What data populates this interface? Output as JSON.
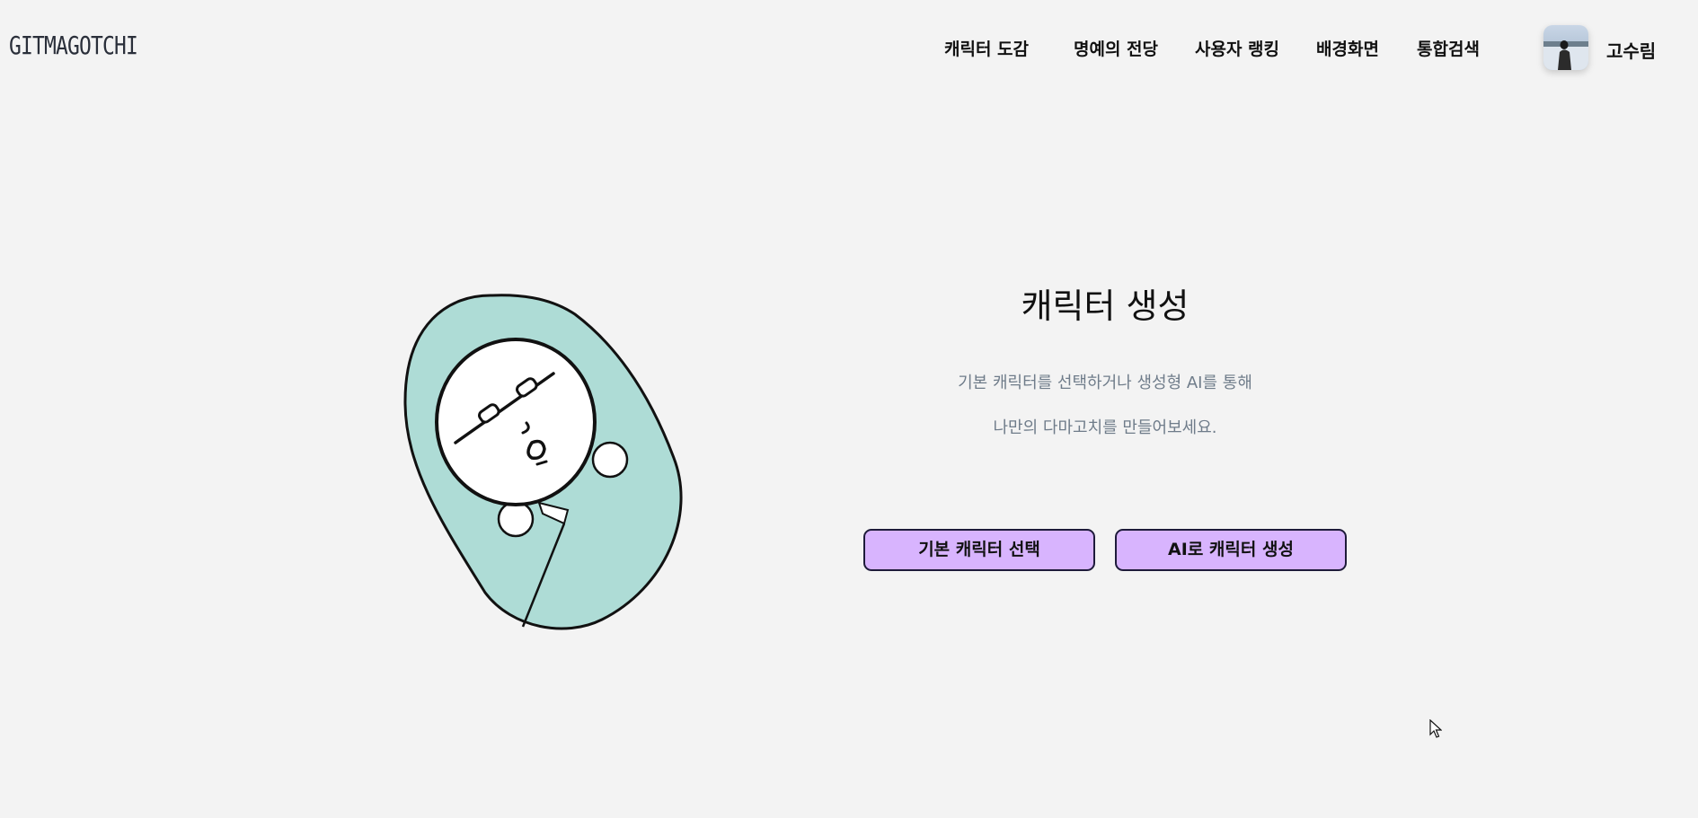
{
  "header": {
    "logo": "GITMAGOTCHI",
    "nav": [
      {
        "label": "캐릭터 도감"
      },
      {
        "label": "명예의 전당"
      },
      {
        "label": "사용자 랭킹"
      },
      {
        "label": "배경화면"
      },
      {
        "label": "통합검색"
      }
    ],
    "user": {
      "name": "고수림"
    }
  },
  "main": {
    "title": "캐릭터 생성",
    "description_line1": "기본 캐릭터를 선택하거나 생성형 AI를 통해",
    "description_line2": "나만의 다마고치를 만들어보세요.",
    "buttons": {
      "basic": "기본 캐릭터 선택",
      "ai": "AI로 캐릭터 생성"
    }
  },
  "colors": {
    "background": "#f3f3f3",
    "button_fill": "#d8b4fe",
    "blanket": "#aedcd6",
    "description_text": "#6f7c8a"
  }
}
